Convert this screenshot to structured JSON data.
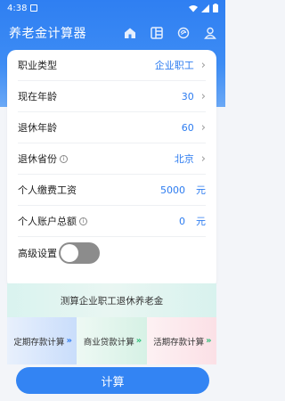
{
  "status_bar": {
    "time": "4:38"
  },
  "app_bar": {
    "title": "养老金计算器",
    "icons": [
      "home-icon",
      "grid-icon",
      "refresh-icon",
      "user-icon"
    ]
  },
  "form": {
    "rows": [
      {
        "label": "职业类型",
        "value": "企业职工",
        "chevron": true
      },
      {
        "label": "现在年龄",
        "value": "30",
        "chevron": true
      },
      {
        "label": "退休年龄",
        "value": "60",
        "chevron": true
      },
      {
        "label": "退休省份",
        "value": "北京",
        "chevron": true,
        "info": true
      },
      {
        "label": "个人缴费工资",
        "value": "5000",
        "unit": "元"
      },
      {
        "label": "个人账户总额",
        "value": "0",
        "unit": "元",
        "info": true
      }
    ],
    "advanced": {
      "label": "高级设置",
      "enabled": false
    }
  },
  "promo": {
    "text": "测算企业职工退休养老金"
  },
  "tools": [
    {
      "label": "定期存款计算",
      "arrows": "»"
    },
    {
      "label": "商业贷款计算",
      "arrows": "»"
    },
    {
      "label": "活期存款计算",
      "arrows": "»"
    }
  ],
  "calculate_button": {
    "label": "计算"
  },
  "colors": {
    "primary": "#3384f3",
    "value": "#2d7cf0"
  }
}
